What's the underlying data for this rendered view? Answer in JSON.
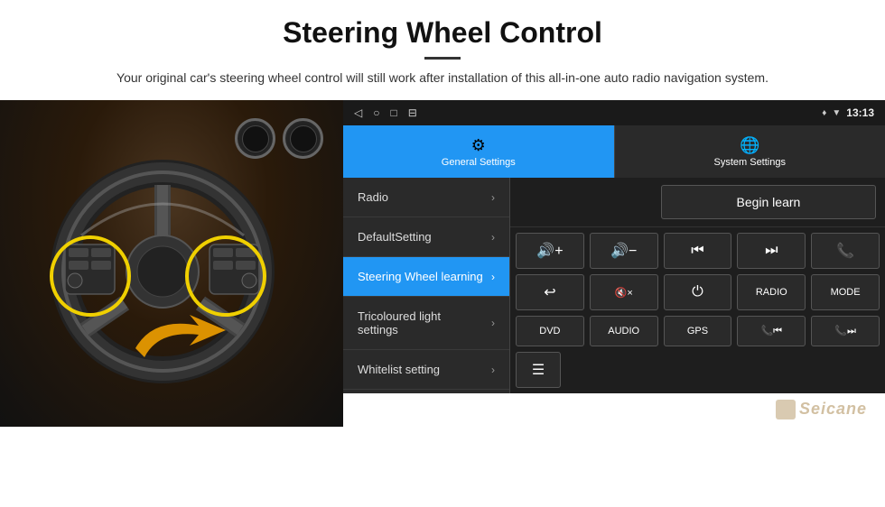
{
  "header": {
    "title": "Steering Wheel Control",
    "description": "Your original car's steering wheel control will still work after installation of this all-in-one auto radio navigation system."
  },
  "status_bar": {
    "time": "13:13",
    "icons": [
      "◁",
      "○",
      "□",
      "⊟"
    ]
  },
  "tabs": [
    {
      "label": "General Settings",
      "active": true
    },
    {
      "label": "System Settings",
      "active": false
    }
  ],
  "menu_items": [
    {
      "label": "Radio",
      "active": false
    },
    {
      "label": "DefaultSetting",
      "active": false
    },
    {
      "label": "Steering Wheel learning",
      "active": true
    },
    {
      "label": "Tricoloured light settings",
      "active": false
    },
    {
      "label": "Whitelist setting",
      "active": false
    }
  ],
  "begin_learn_btn": "Begin learn",
  "control_rows": [
    [
      {
        "icon": "🔊+",
        "label": "vol-up"
      },
      {
        "icon": "🔊−",
        "label": "vol-down"
      },
      {
        "icon": "⏮",
        "label": "prev"
      },
      {
        "icon": "⏭",
        "label": "next"
      },
      {
        "icon": "📞",
        "label": "call"
      }
    ],
    [
      {
        "icon": "↩",
        "label": "hang-up"
      },
      {
        "icon": "🔇×",
        "label": "mute"
      },
      {
        "icon": "⏻",
        "label": "power"
      },
      {
        "icon": "RADIO",
        "label": "radio"
      },
      {
        "icon": "MODE",
        "label": "mode"
      }
    ],
    [
      {
        "icon": "DVD",
        "label": "dvd"
      },
      {
        "icon": "AUDIO",
        "label": "audio"
      },
      {
        "icon": "GPS",
        "label": "gps"
      },
      {
        "icon": "📞⏮",
        "label": "call-prev"
      },
      {
        "icon": "📞⏭",
        "label": "call-next"
      }
    ]
  ]
}
